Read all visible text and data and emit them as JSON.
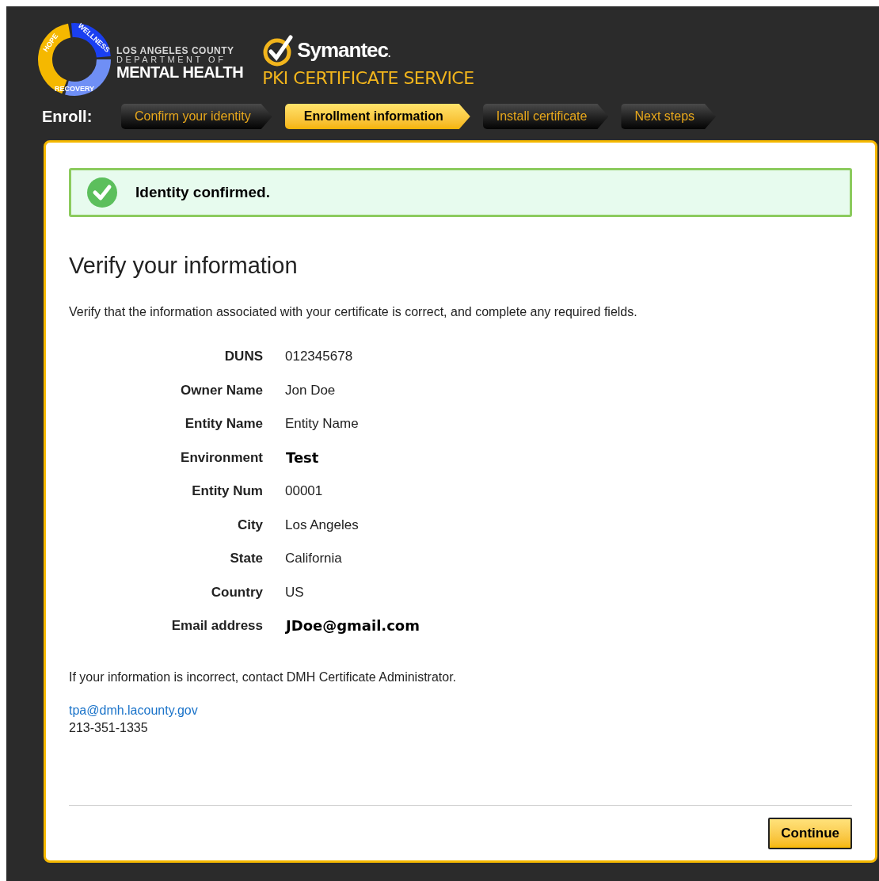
{
  "header": {
    "dmh_logo": {
      "ring_labels": [
        "HOPE",
        "WELLNESS",
        "RECOVERY"
      ],
      "line_1": "LOS ANGELES COUNTY",
      "line_2": "DEPARTMENT OF",
      "line_3": "MENTAL HEALTH"
    },
    "symantec_logo": {
      "name": "Symantec",
      "mark": "."
    },
    "service_title": "PKI CERTIFICATE SERVICE"
  },
  "steps_label": "Enroll:",
  "steps": [
    {
      "label": "Confirm your identity",
      "selected": false
    },
    {
      "label": "Enrollment information",
      "selected": true
    },
    {
      "label": "Install certificate",
      "selected": false
    },
    {
      "label": "Next steps",
      "selected": false
    }
  ],
  "alert": {
    "message": "Identity confirmed."
  },
  "heading": "Verify your information",
  "intro": "Verify that the information associated with your certificate is correct, and complete any required fields.",
  "fields": [
    {
      "label": "DUNS",
      "value": "012345678",
      "emphasis": false
    },
    {
      "label": "Owner Name",
      "value": "Jon Doe",
      "emphasis": false
    },
    {
      "label": "Entity Name",
      "value": "Entity Name",
      "emphasis": false
    },
    {
      "label": "Environment",
      "value": "Test",
      "emphasis": true
    },
    {
      "label": "Entity Num",
      "value": "00001",
      "emphasis": false
    },
    {
      "label": "City",
      "value": "Los Angeles",
      "emphasis": false
    },
    {
      "label": "State",
      "value": "California",
      "emphasis": false
    },
    {
      "label": "Country",
      "value": "US",
      "emphasis": false
    },
    {
      "label": "Email address",
      "value": "JDoe@gmail.com",
      "emphasis": true
    }
  ],
  "contact_note": "If your information is incorrect, contact DMH Certificate Administrator.",
  "contact_email": "tpa@dmh.lacounty.gov",
  "contact_phone": "213-351-1335",
  "continue_button": "Continue"
}
